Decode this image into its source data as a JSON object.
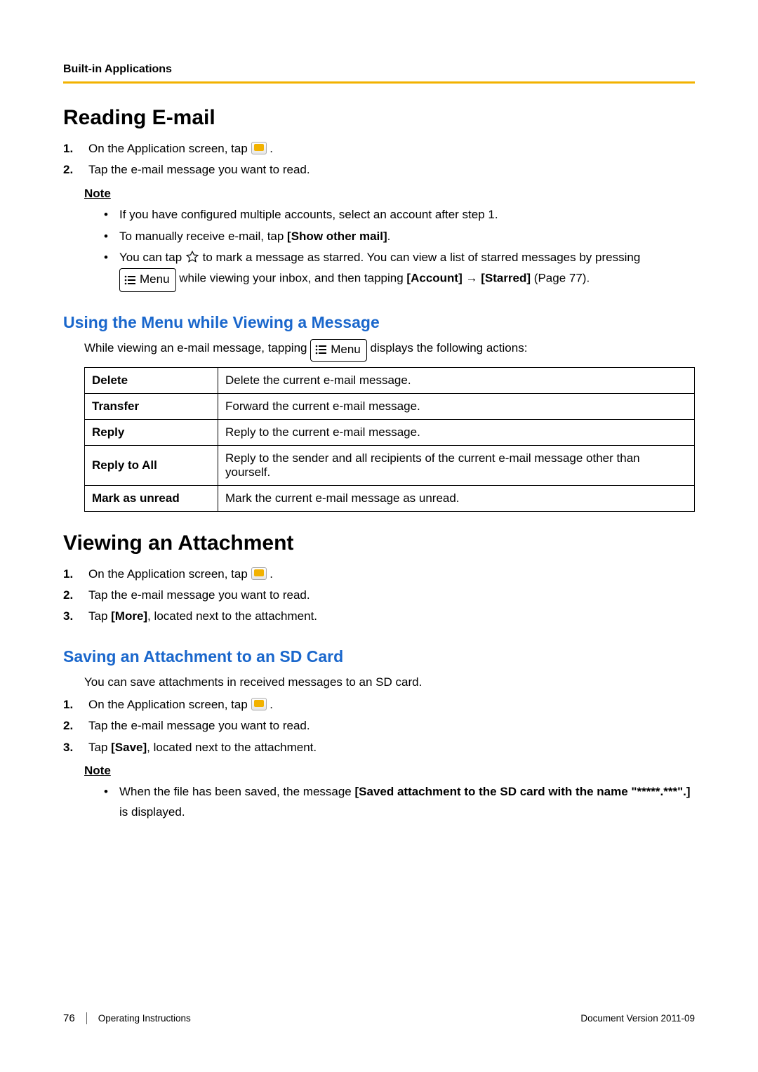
{
  "header": {
    "section_label": "Built-in Applications"
  },
  "reading_email": {
    "title": "Reading E-mail",
    "steps": {
      "s1_pre": "On the Application screen, tap ",
      "s1_post": " .",
      "s2": "Tap the e-mail message you want to read."
    },
    "note_label": "Note",
    "note_b1": "If you have configured multiple accounts, select an account after step 1.",
    "note_b2_pre": "To manually receive e-mail, tap ",
    "note_b2_bold": "[Show other mail]",
    "note_b2_post": ".",
    "note_b3_pre": "You can tap ",
    "note_b3_mid": " to mark a message as starred. You can view a list of starred messages by pressing ",
    "note_b3_line2_pre": " while viewing your inbox, and then tapping ",
    "note_b3_bold1": "[Account]",
    "note_b3_arrow": " → ",
    "note_b3_bold2": "[Starred]",
    "note_b3_post": " (Page 77).",
    "menu_label": "Menu"
  },
  "using_menu": {
    "title": "Using the Menu while Viewing a Message",
    "intro_pre": "While viewing an e-mail message, tapping ",
    "intro_post": " displays the following actions:",
    "menu_label": "Menu",
    "rows": {
      "r1k": "Delete",
      "r1v": "Delete the current e-mail message.",
      "r2k": "Transfer",
      "r2v": "Forward the current e-mail message.",
      "r3k": "Reply",
      "r3v": "Reply to the current e-mail message.",
      "r4k": "Reply to All",
      "r4v": "Reply to the sender and all recipients of the current e-mail message other than yourself.",
      "r5k": "Mark as unread",
      "r5v": "Mark the current e-mail message as unread."
    }
  },
  "viewing_attachment": {
    "title": "Viewing an Attachment",
    "steps": {
      "s1_pre": "On the Application screen, tap ",
      "s1_post": " .",
      "s2": "Tap the e-mail message you want to read.",
      "s3_pre": "Tap ",
      "s3_bold": "[More]",
      "s3_post": ", located next to the attachment."
    }
  },
  "saving_attachment": {
    "title": "Saving an Attachment to an SD Card",
    "intro": "You can save attachments in received messages to an SD card.",
    "steps": {
      "s1_pre": "On the Application screen, tap ",
      "s1_post": " .",
      "s2": "Tap the e-mail message you want to read.",
      "s3_pre": "Tap ",
      "s3_bold": "[Save]",
      "s3_post": ", located next to the attachment."
    },
    "note_label": "Note",
    "note_b1_pre": "When the file has been saved, the message ",
    "note_b1_bold": "[Saved attachment to the SD card with the name \"*****.***\".]",
    "note_b1_post": " is displayed."
  },
  "footer": {
    "page_number": "76",
    "doc_title": "Operating Instructions",
    "doc_version": "Document Version   2011-09"
  }
}
